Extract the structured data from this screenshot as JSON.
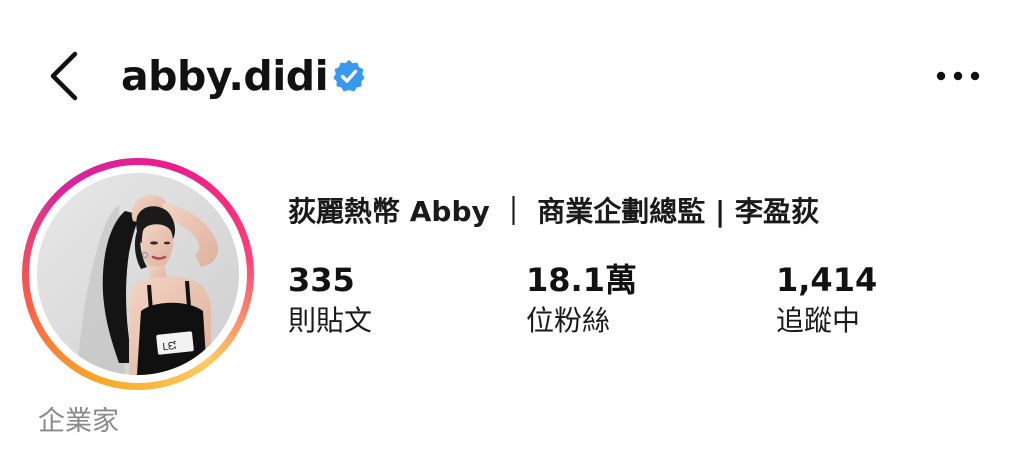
{
  "header": {
    "username": "abby.didi",
    "verified": true,
    "back_icon": "chevron-left-icon",
    "more_icon": "more-horizontal-icon",
    "verified_icon": "verified-badge-icon",
    "verified_color": "#3897f0"
  },
  "profile": {
    "avatar_icon": "profile-photo",
    "story_ring_colors": [
      "#f9a825",
      "#fd5949",
      "#d6249f",
      "#ec1c8c"
    ],
    "bio_name": "荻麗熱幣 Abby ｜ 商業企劃總監 | 李盈荻",
    "category": "企業家"
  },
  "stats": [
    {
      "value": "335",
      "label": "則貼文"
    },
    {
      "value": "18.1萬",
      "label": "位粉絲"
    },
    {
      "value": "1,414",
      "label": "追蹤中"
    }
  ]
}
